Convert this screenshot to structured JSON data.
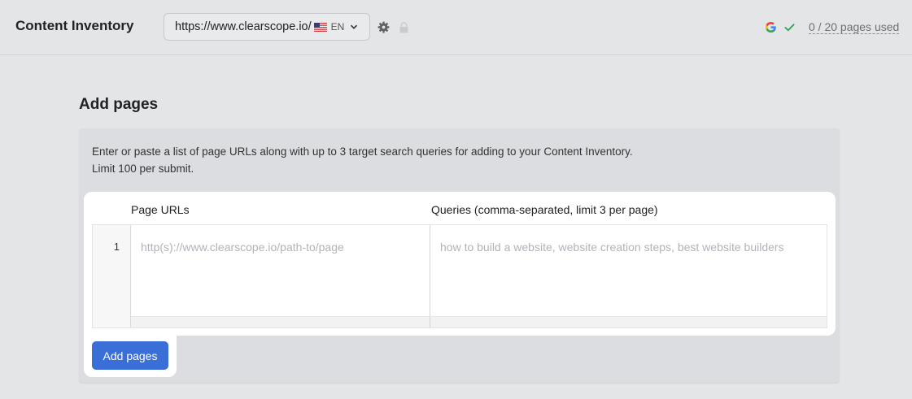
{
  "header": {
    "title": "Content Inventory",
    "site": {
      "url": "https://www.clearscope.io/",
      "lang": "EN",
      "flag_icon": "us-flag-icon"
    },
    "icons": [
      "chevron-down-icon",
      "gear-icon",
      "lock-icon",
      "google-icon",
      "check-icon"
    ],
    "usage": "0 / 20 pages used"
  },
  "main": {
    "title": "Add pages",
    "description_line1": "Enter or paste a list of page URLs along with up to 3 target search queries for adding to your Content Inventory.",
    "description_line2": "Limit 100 per submit.",
    "table": {
      "col_urls": "Page URLs",
      "col_queries": "Queries (comma-separated, limit 3 per page)",
      "rows": [
        {
          "num": "1",
          "url_placeholder": "http(s)://www.clearscope.io/path-to/page",
          "queries_placeholder": "how to build a website, website creation steps, best website builders"
        }
      ]
    },
    "submit_label": "Add pages"
  },
  "colors": {
    "accent": "#3a6fd8",
    "overlay_bg": "#e4e5e7",
    "check": "#2f9e5a"
  }
}
